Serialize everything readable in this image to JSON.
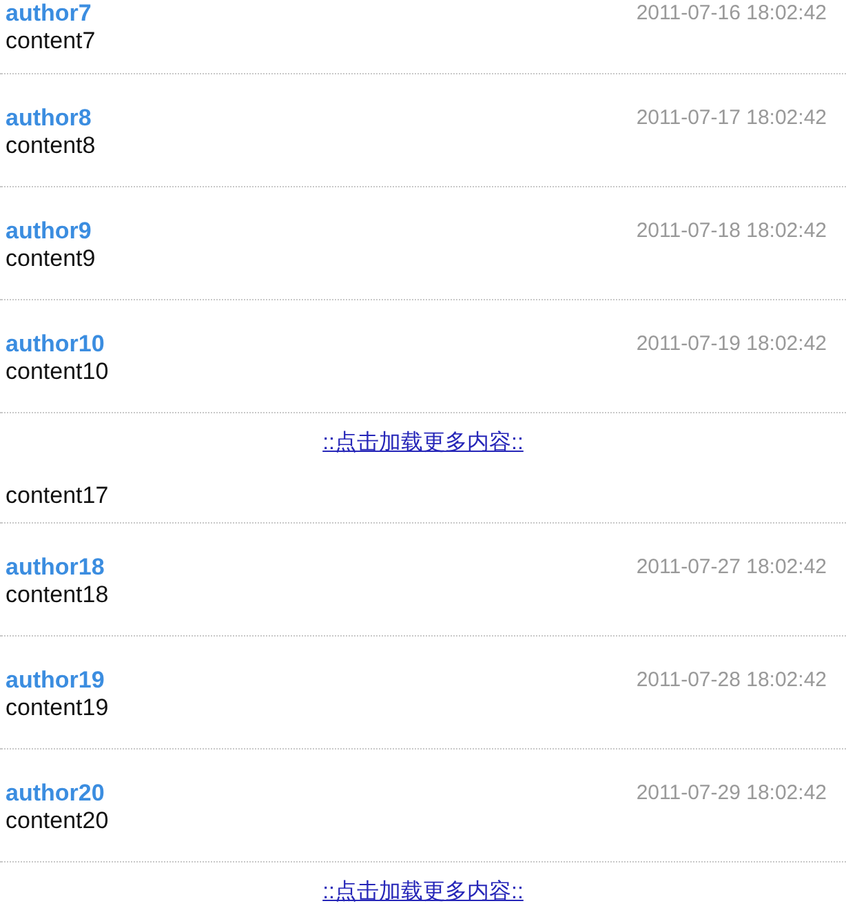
{
  "sections": [
    {
      "items": [
        {
          "author": "author7",
          "date": "2011-07-16 18:02:42",
          "content": "content7"
        },
        {
          "author": "author8",
          "date": "2011-07-17 18:02:42",
          "content": "content8"
        },
        {
          "author": "author9",
          "date": "2011-07-18 18:02:42",
          "content": "content9"
        },
        {
          "author": "author10",
          "date": "2011-07-19 18:02:42",
          "content": "content10"
        }
      ],
      "load_more": "::点击加载更多内容::"
    },
    {
      "items": [
        {
          "content": "content17"
        },
        {
          "author": "author18",
          "date": "2011-07-27 18:02:42",
          "content": "content18"
        },
        {
          "author": "author19",
          "date": "2011-07-28 18:02:42",
          "content": "content19"
        },
        {
          "author": "author20",
          "date": "2011-07-29 18:02:42",
          "content": "content20"
        }
      ],
      "load_more": "::点击加载更多内容::"
    }
  ]
}
